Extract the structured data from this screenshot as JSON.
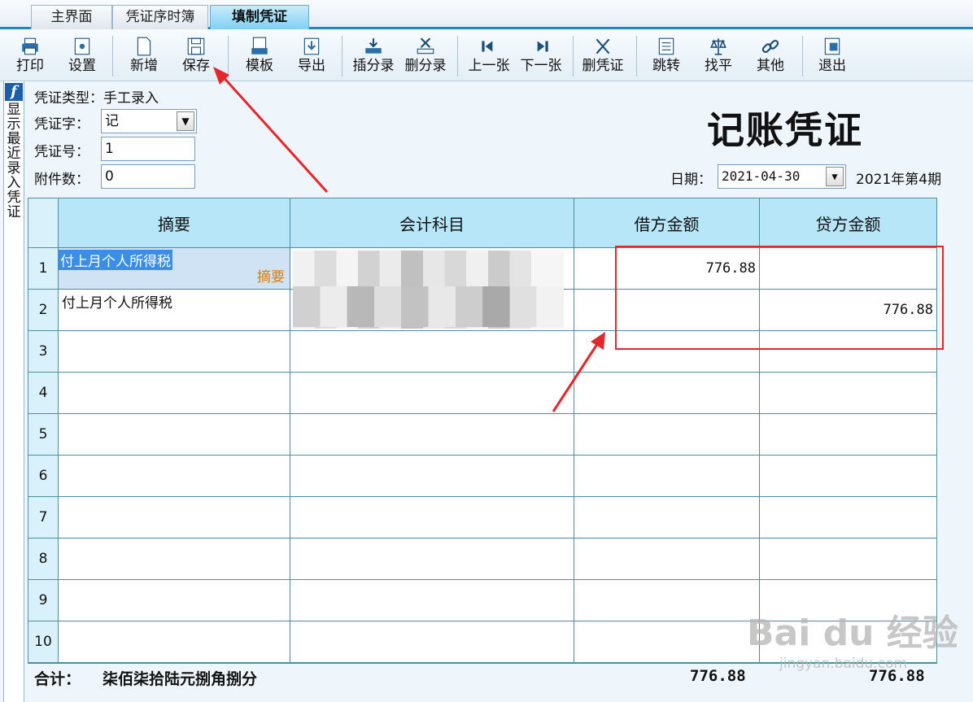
{
  "tabs": [
    {
      "label": "主界面"
    },
    {
      "label": "凭证序时簿"
    },
    {
      "label": "填制凭证"
    }
  ],
  "toolbar": {
    "print": "打印",
    "settings": "设置",
    "new": "新增",
    "save": "保存",
    "template": "模板",
    "export": "导出",
    "insert_entry": "插分录",
    "delete_entry": "删分录",
    "prev": "上一张",
    "next": "下一张",
    "delete_voucher": "删凭证",
    "jump": "跳转",
    "balance": "找平",
    "other": "其他",
    "exit": "退出"
  },
  "sidebar": {
    "label": "显示最近录入凭证"
  },
  "header": {
    "voucher_type_label": "凭证类型：",
    "voucher_type_value": "手工录入",
    "voucher_word_label": "凭证字：",
    "voucher_word_value": "记",
    "voucher_no_label": "凭证号：",
    "voucher_no_value": "1",
    "attachments_label": "附件数：",
    "attachments_value": "0",
    "title": "记账凭证",
    "date_label": "日期：",
    "date_value": "2021-04-30",
    "period": "2021年第4期"
  },
  "grid": {
    "columns": [
      "摘要",
      "会计科目",
      "借方金额",
      "贷方金额"
    ],
    "rows": [
      {
        "no": "1",
        "summary": "付上月个人所得税",
        "hint": "摘要",
        "debit": "776.88",
        "credit": ""
      },
      {
        "no": "2",
        "summary": "付上月个人所得税",
        "debit": "",
        "credit": "776.88"
      },
      {
        "no": "3"
      },
      {
        "no": "4"
      },
      {
        "no": "5"
      },
      {
        "no": "6"
      },
      {
        "no": "7"
      },
      {
        "no": "8"
      },
      {
        "no": "9"
      },
      {
        "no": "10"
      }
    ]
  },
  "totals": {
    "label": "合计：",
    "in_words": "柒佰柒拾陆元捌角捌分",
    "debit": "776.88",
    "credit": "776.88"
  },
  "watermark": {
    "brand": "Bai du 经验",
    "url": "jingyan.baidu.com"
  },
  "colors": {
    "accent": "#1f87c9",
    "header_fill": "#b6e6f7",
    "annotation": "#e5262b"
  }
}
